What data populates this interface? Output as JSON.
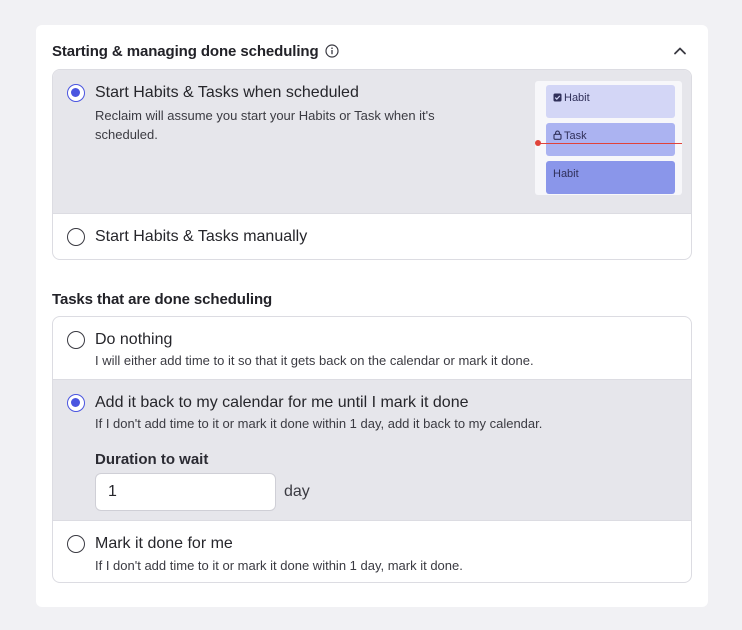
{
  "section1": {
    "title": "Starting & managing done scheduling",
    "options": [
      {
        "title": "Start Habits & Tasks when scheduled",
        "desc_line1": "Reclaim will assume you start your Habits or Task when it's",
        "desc_line2": "scheduled.",
        "selected": true
      },
      {
        "title": "Start Habits & Tasks manually",
        "selected": false
      }
    ],
    "preview": {
      "habit_top": "Habit",
      "task": "Task",
      "habit_bottom": "Habit"
    }
  },
  "section2": {
    "title": "Tasks that are done scheduling",
    "options": [
      {
        "title": "Do nothing",
        "desc": "I will either add time to it so that it gets back on the calendar or mark it done.",
        "selected": false
      },
      {
        "title": "Add it back to my calendar for me until I mark it done",
        "desc": "If I don't add time to it or mark it done within 1 day, add it back to my calendar.",
        "selected": true,
        "duration_label": "Duration to wait",
        "duration_value": "1",
        "duration_unit": "day"
      },
      {
        "title": "Mark it done for me",
        "desc": "If I don't add time to it or mark it done within 1 day, mark it done.",
        "selected": false
      }
    ]
  },
  "colors": {
    "accent": "#4a55e0",
    "selected_bg": "#e6e6eb",
    "page_bg": "#f1f1f4",
    "now_line": "#e0433a"
  },
  "icons": [
    "info-icon",
    "chevron-up-icon",
    "checkbox-icon",
    "lock-icon"
  ]
}
